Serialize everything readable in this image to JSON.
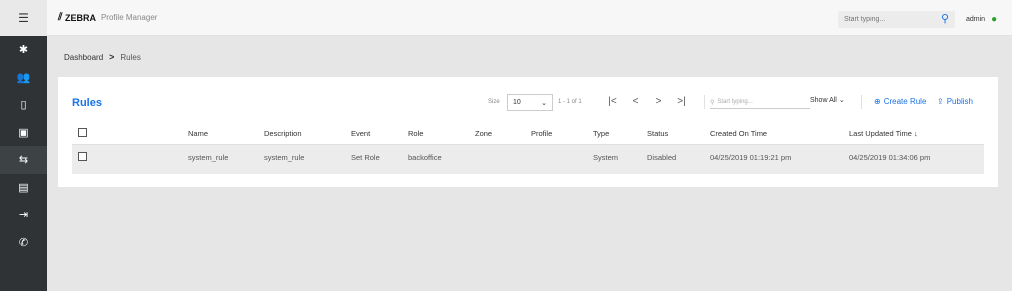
{
  "header": {
    "brand": "ZEBRA",
    "product": "Profile Manager",
    "search_placeholder": "Start typing...",
    "user": "admin"
  },
  "sidebar": {
    "items": [
      {
        "icon": "gear-icon"
      },
      {
        "icon": "people-icon"
      },
      {
        "icon": "phone-icon"
      },
      {
        "icon": "badge-icon"
      },
      {
        "icon": "rules-icon",
        "active": true
      },
      {
        "icon": "layers-icon"
      },
      {
        "icon": "device-exit-icon"
      },
      {
        "icon": "call-icon"
      }
    ]
  },
  "breadcrumb": {
    "root": "Dashboard",
    "current": "Rules"
  },
  "rules": {
    "title": "Rules",
    "size_label": "Size",
    "size_value": "10",
    "range": "1 - 1 of 1",
    "filter_placeholder": "Start typing...",
    "show_all": "Show All",
    "create_label": "Create Rule",
    "publish_label": "Publish",
    "columns": [
      "Name",
      "Description",
      "Event",
      "Role",
      "Zone",
      "Profile",
      "Type",
      "Status",
      "Created On Time",
      "Last Updated Time ↓"
    ],
    "rows": [
      [
        "system_rule",
        "system_rule",
        "Set Role",
        "backoffice",
        "",
        "",
        "System",
        "Disabled",
        "04/25/2019 01:19:21 pm",
        "04/25/2019 01:34:06 pm"
      ]
    ]
  },
  "colors": {
    "accent": "#1a73e8",
    "sidebar": "#2f3336",
    "user_icon": "#2aa02a"
  }
}
